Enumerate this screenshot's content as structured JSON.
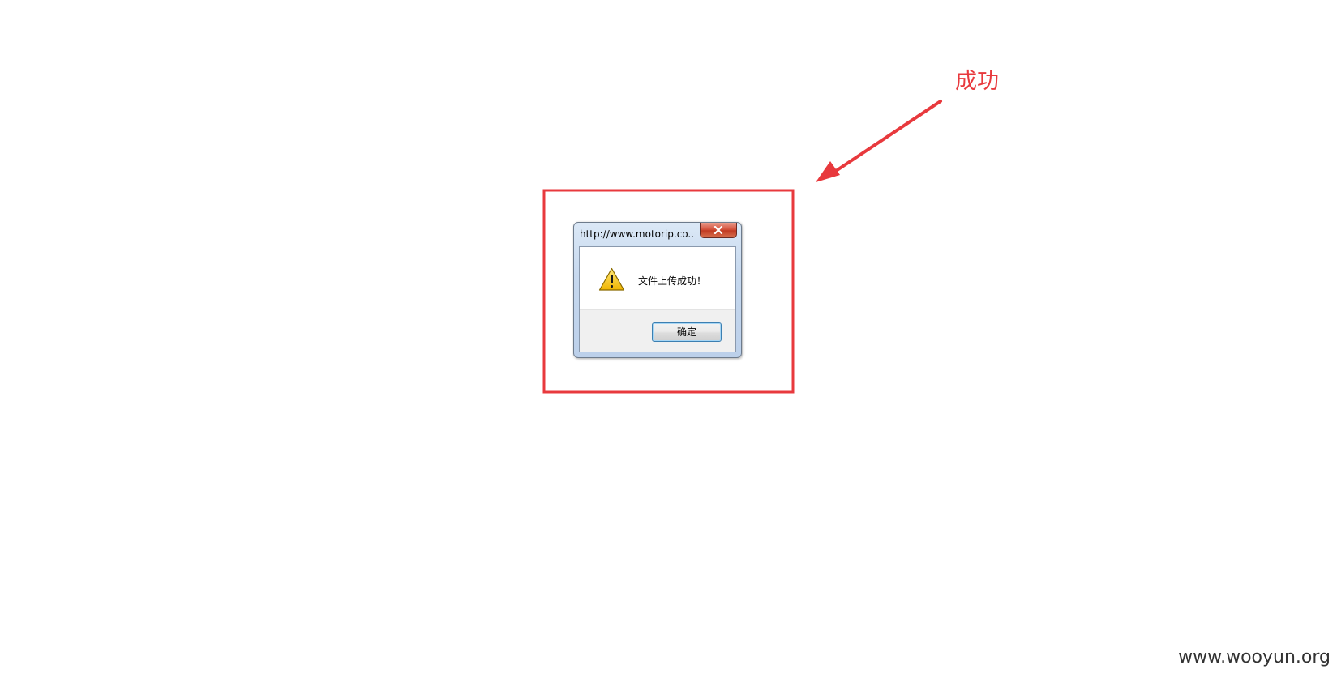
{
  "annotation": {
    "label": "成功",
    "color": "#e8393d"
  },
  "dialog": {
    "title": "http://www.motorip.co...",
    "icon": "warning-icon",
    "message": "文件上传成功！",
    "ok_label": "确定",
    "close_icon": "close-icon"
  },
  "watermark": "www.wooyun.org"
}
